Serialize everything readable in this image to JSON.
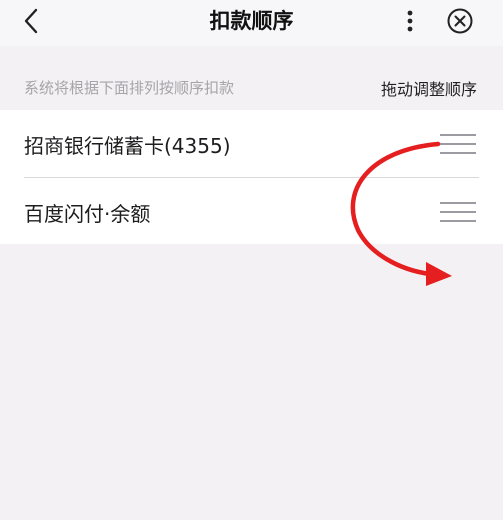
{
  "header": {
    "title": "扣款顺序",
    "icons": {
      "back": "chevron-left-icon",
      "more": "more-vertical-icon",
      "close": "close-circle-icon"
    }
  },
  "subbar": {
    "hint": "系统将根据下面排列按顺序扣款",
    "adjust_label": "拖动调整顺序"
  },
  "list": {
    "items": [
      {
        "label": "招商银行储蓄卡(4355)",
        "handle_icon": "drag-handle-icon"
      },
      {
        "label": "百度闪付·余额",
        "handle_icon": "drag-handle-icon"
      }
    ]
  },
  "colors": {
    "annotation_arrow": "#e51f1f",
    "background": "#f3f1f4"
  }
}
